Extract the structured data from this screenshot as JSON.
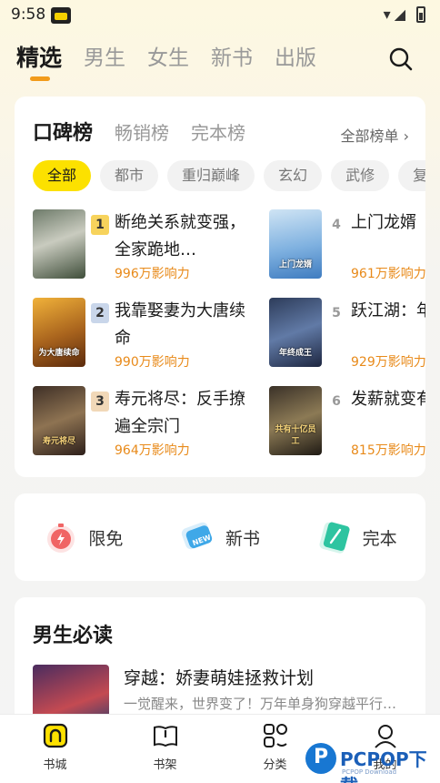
{
  "status_bar": {
    "time": "9:58"
  },
  "top_tabs": [
    "精选",
    "男生",
    "女生",
    "新书",
    "出版"
  ],
  "ranking": {
    "tabs": [
      "口碑榜",
      "畅销榜",
      "完本榜"
    ],
    "all_list": "全部榜单 ›",
    "categories": [
      "全部",
      "都市",
      "重归巅峰",
      "玄幻",
      "武修",
      "复"
    ],
    "books": [
      {
        "rank": "1",
        "title": "断绝关系就变强，全家跪地…",
        "impact": "996万影响力",
        "cover_text": ""
      },
      {
        "rank": "2",
        "title": "我靠娶妻为大唐续命",
        "impact": "990万影响力",
        "cover_text": "为大唐续命"
      },
      {
        "rank": "3",
        "title": "寿元将尽：反手撩遍全宗门",
        "impact": "964万影响力",
        "cover_text": "寿元将尽"
      },
      {
        "rank": "4",
        "title": "上门龙婿",
        "impact": "961万影响力",
        "cover_text": "上门龙婿"
      },
      {
        "rank": "5",
        "title": "跃江湖：年终成王",
        "impact": "929万影响力",
        "cover_text": "年终成王"
      },
      {
        "rank": "6",
        "title": "发薪就变有十亿员",
        "impact": "815万影响力",
        "cover_text": "共有十亿员工"
      }
    ]
  },
  "quick_entries": [
    {
      "label": "限免",
      "icon": "stopwatch-icon",
      "color": "#f06565"
    },
    {
      "label": "新书",
      "icon": "new-tag-icon",
      "color": "#3fa8e8"
    },
    {
      "label": "完本",
      "icon": "book-complete-icon",
      "color": "#2ec4a0"
    }
  ],
  "must_read": {
    "title": "男生必读",
    "book": {
      "title": "穿越：娇妻萌娃拯救计划",
      "desc": "一觉醒来，世界变了！万年单身狗穿越平行…"
    }
  },
  "bottom_nav": [
    "书城",
    "书架",
    "分类",
    "我的"
  ],
  "watermark": {
    "text": "PCPOP下载",
    "sub": "PCPOP Download"
  },
  "colors": {
    "accent": "#fce100",
    "impact": "#e88a1a",
    "underline": "#f29b1b"
  }
}
